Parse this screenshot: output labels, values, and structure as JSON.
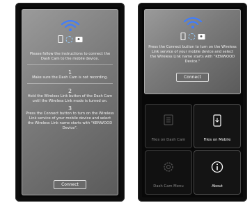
{
  "left_screen": {
    "instruction": "Please follow the instructions to connect the Dash Cam to the mobile device.",
    "steps": [
      {
        "number": "1",
        "text": "Make sure the Dash Cam is not recording."
      },
      {
        "number": "2",
        "text": "Hold the Wireless Link button of the Dash Cam until the Wireless Link mode is turned on."
      },
      {
        "number": "3",
        "text": "Press the Connect button to turn on the Wireless Link service of your mobile device and select the Wireless Link name starts with \"KENWOOD Device\"."
      }
    ],
    "connect_label": "Connect"
  },
  "right_screen": {
    "instruction": "Press the Connect button to turn on the Wireless Link service of your mobile device and select the Wireless Link name starts with \"KENWOOD Device.\"",
    "connect_label": "Connect",
    "tiles": [
      {
        "label": "Files on Dash Cam",
        "icon": "dashcam-files-icon",
        "enabled": false
      },
      {
        "label": "Files on Mobile",
        "icon": "mobile-files-icon",
        "enabled": true
      },
      {
        "label": "Dash Cam Menu",
        "icon": "gear-icon",
        "enabled": false
      },
      {
        "label": "About",
        "icon": "info-icon",
        "enabled": true
      }
    ]
  },
  "colors": {
    "wifi_accent": "#3f7dff",
    "panel": "#7a7a7a",
    "tile_background": "#111111"
  }
}
